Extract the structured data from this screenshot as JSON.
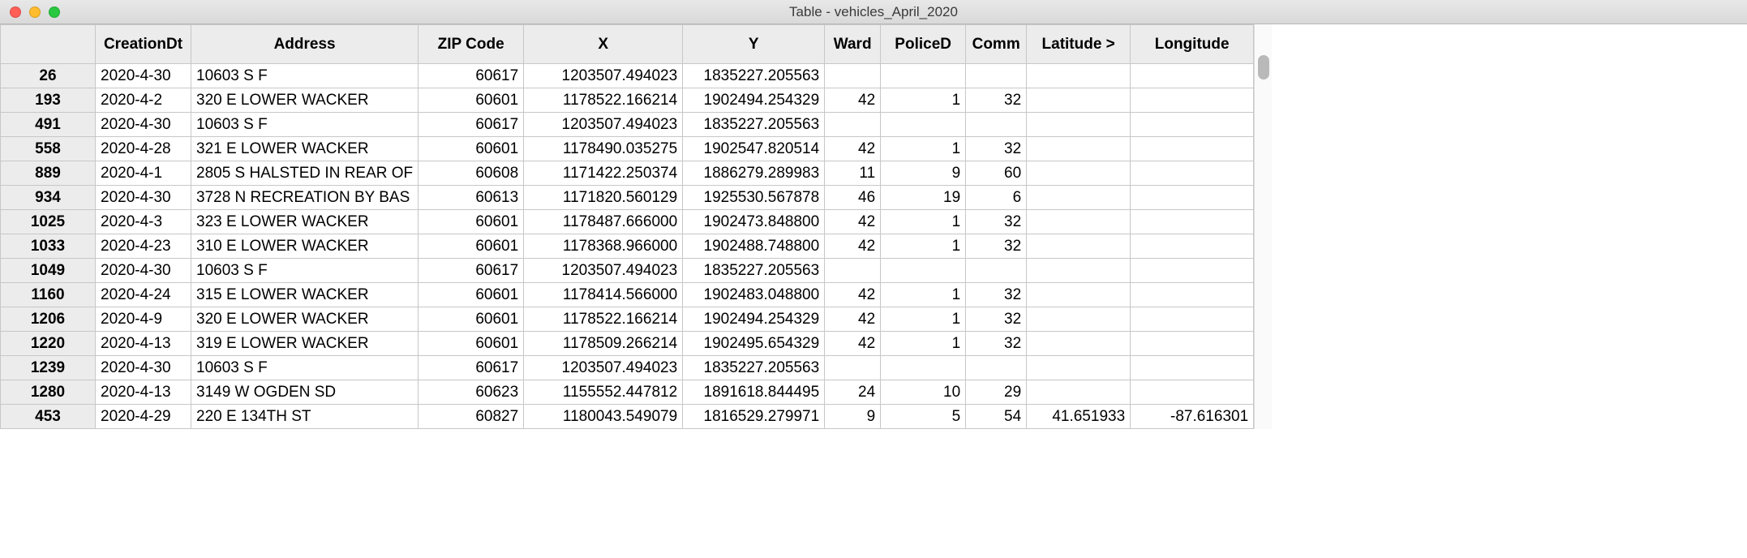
{
  "window": {
    "title": "Table - vehicles_April_2020"
  },
  "columns": [
    "CreationDt",
    "Address",
    "ZIP Code",
    "X",
    "Y",
    "Ward",
    "PoliceD",
    "Comm",
    "Latitude >",
    "Longitude"
  ],
  "rows": [
    {
      "id": "26",
      "date": "2020-4-30",
      "addr": "10603 S F",
      "zip": "60617",
      "x": "1203507.494023",
      "y": "1835227.205563",
      "ward": "",
      "pol": "",
      "comm": "",
      "lat": "",
      "lon": ""
    },
    {
      "id": "193",
      "date": "2020-4-2",
      "addr": "320 E LOWER WACKER",
      "zip": "60601",
      "x": "1178522.166214",
      "y": "1902494.254329",
      "ward": "42",
      "pol": "1",
      "comm": "32",
      "lat": "",
      "lon": ""
    },
    {
      "id": "491",
      "date": "2020-4-30",
      "addr": "10603 S F",
      "zip": "60617",
      "x": "1203507.494023",
      "y": "1835227.205563",
      "ward": "",
      "pol": "",
      "comm": "",
      "lat": "",
      "lon": ""
    },
    {
      "id": "558",
      "date": "2020-4-28",
      "addr": "321 E LOWER WACKER",
      "zip": "60601",
      "x": "1178490.035275",
      "y": "1902547.820514",
      "ward": "42",
      "pol": "1",
      "comm": "32",
      "lat": "",
      "lon": ""
    },
    {
      "id": "889",
      "date": "2020-4-1",
      "addr": "2805 S HALSTED IN REAR OF",
      "zip": "60608",
      "x": "1171422.250374",
      "y": "1886279.289983",
      "ward": "11",
      "pol": "9",
      "comm": "60",
      "lat": "",
      "lon": ""
    },
    {
      "id": "934",
      "date": "2020-4-30",
      "addr": "3728 N RECREATION BY BAS",
      "zip": "60613",
      "x": "1171820.560129",
      "y": "1925530.567878",
      "ward": "46",
      "pol": "19",
      "comm": "6",
      "lat": "",
      "lon": ""
    },
    {
      "id": "1025",
      "date": "2020-4-3",
      "addr": "323 E LOWER WACKER",
      "zip": "60601",
      "x": "1178487.666000",
      "y": "1902473.848800",
      "ward": "42",
      "pol": "1",
      "comm": "32",
      "lat": "",
      "lon": ""
    },
    {
      "id": "1033",
      "date": "2020-4-23",
      "addr": "310 E LOWER WACKER",
      "zip": "60601",
      "x": "1178368.966000",
      "y": "1902488.748800",
      "ward": "42",
      "pol": "1",
      "comm": "32",
      "lat": "",
      "lon": ""
    },
    {
      "id": "1049",
      "date": "2020-4-30",
      "addr": "10603 S F",
      "zip": "60617",
      "x": "1203507.494023",
      "y": "1835227.205563",
      "ward": "",
      "pol": "",
      "comm": "",
      "lat": "",
      "lon": ""
    },
    {
      "id": "1160",
      "date": "2020-4-24",
      "addr": "315 E LOWER WACKER",
      "zip": "60601",
      "x": "1178414.566000",
      "y": "1902483.048800",
      "ward": "42",
      "pol": "1",
      "comm": "32",
      "lat": "",
      "lon": ""
    },
    {
      "id": "1206",
      "date": "2020-4-9",
      "addr": "320 E LOWER WACKER",
      "zip": "60601",
      "x": "1178522.166214",
      "y": "1902494.254329",
      "ward": "42",
      "pol": "1",
      "comm": "32",
      "lat": "",
      "lon": ""
    },
    {
      "id": "1220",
      "date": "2020-4-13",
      "addr": "319 E LOWER WACKER",
      "zip": "60601",
      "x": "1178509.266214",
      "y": "1902495.654329",
      "ward": "42",
      "pol": "1",
      "comm": "32",
      "lat": "",
      "lon": ""
    },
    {
      "id": "1239",
      "date": "2020-4-30",
      "addr": "10603 S F",
      "zip": "60617",
      "x": "1203507.494023",
      "y": "1835227.205563",
      "ward": "",
      "pol": "",
      "comm": "",
      "lat": "",
      "lon": ""
    },
    {
      "id": "1280",
      "date": "2020-4-13",
      "addr": "3149 W OGDEN SD",
      "zip": "60623",
      "x": "1155552.447812",
      "y": "1891618.844495",
      "ward": "24",
      "pol": "10",
      "comm": "29",
      "lat": "",
      "lon": ""
    },
    {
      "id": "453",
      "date": "2020-4-29",
      "addr": "220 E 134TH ST",
      "zip": "60827",
      "x": "1180043.549079",
      "y": "1816529.279971",
      "ward": "9",
      "pol": "5",
      "comm": "54",
      "lat": "41.651933",
      "lon": "-87.616301"
    }
  ]
}
